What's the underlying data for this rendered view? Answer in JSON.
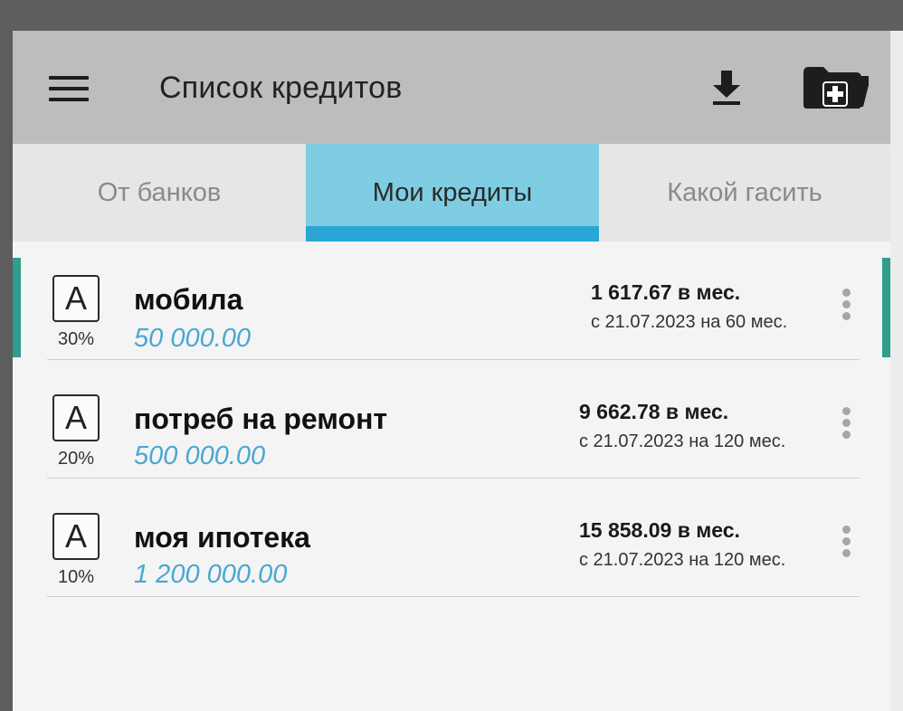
{
  "appbar": {
    "title": "Список кредитов",
    "menu_icon": "hamburger-menu-icon",
    "download_icon": "download-icon",
    "add_folder_icon": "folder-add-icon"
  },
  "tabs": [
    {
      "label": "От банков",
      "active": false
    },
    {
      "label": "Мои кредиты",
      "active": true
    },
    {
      "label": "Какой гасить",
      "active": false
    }
  ],
  "loans": [
    {
      "letter": "А",
      "percent": "30%",
      "name": "мобила",
      "amount": "50 000.00",
      "monthly": "1 617.67  в мес.",
      "period": "с 21.07.2023 на 60 мес."
    },
    {
      "letter": "А",
      "percent": "20%",
      "name": "потреб на ремонт",
      "amount": "500 000.00",
      "monthly": "9 662.78  в мес.",
      "period": "с 21.07.2023 на 120 мес."
    },
    {
      "letter": "А",
      "percent": "10%",
      "name": "моя ипотека",
      "amount": "1 200 000.00",
      "monthly": "15 858.09  в мес.",
      "period": "с 21.07.2023 на 120 мес."
    }
  ],
  "colors": {
    "accent_tab": "#7fcde3",
    "tab_underline": "#2aa6d6",
    "amount_text": "#4aa7d3",
    "selected_marker": "#2e9d8c"
  }
}
